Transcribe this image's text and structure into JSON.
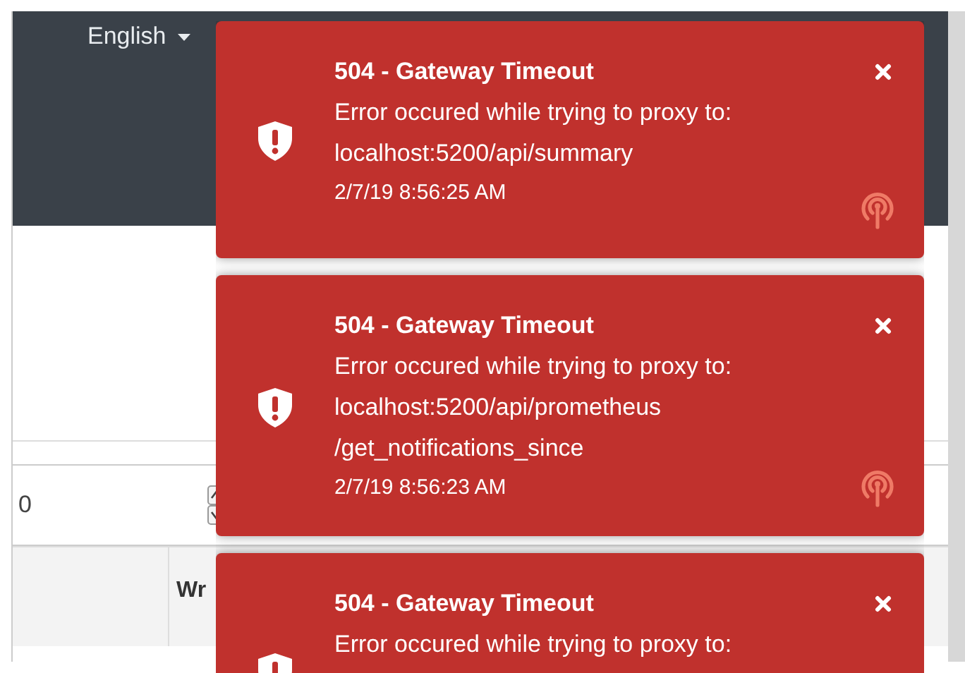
{
  "header": {
    "language": "English"
  },
  "quantity_field": {
    "value": "0"
  },
  "table": {
    "columns": [
      {
        "label": "Wr"
      }
    ]
  },
  "toasts": [
    {
      "title": "504 - Gateway Timeout",
      "message": "Error occured while trying to proxy to:",
      "url_lines": [
        "localhost:5200/api/summary"
      ],
      "time": "2/7/19 8:56:25 AM"
    },
    {
      "title": "504 - Gateway Timeout",
      "message": "Error occured while trying to proxy to:",
      "url_lines": [
        "localhost:5200/api/prometheus",
        "/get_notifications_since"
      ],
      "time": "2/7/19 8:56:23 AM"
    },
    {
      "title": "504 - Gateway Timeout",
      "message": "Error occured while trying to proxy to:"
    }
  ]
}
